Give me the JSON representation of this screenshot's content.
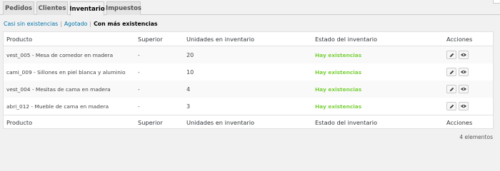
{
  "tabs": [
    "Pedidos",
    "Clientes",
    "Inventario",
    "Impuestos"
  ],
  "filters": {
    "low": "Casi sin existencias",
    "out": "Agotado",
    "most": "Con más existencias"
  },
  "columns": {
    "product": "Producto",
    "parent": "Superior",
    "units": "Unidades en inventario",
    "status": "Estado del inventario",
    "actions": "Acciones"
  },
  "rows": [
    {
      "product": "vest_005 - Mesa de comedor en madera",
      "parent": "-",
      "units": "20",
      "status": "Hay existencias"
    },
    {
      "product": "cami_009 - Sillones en piel blanca y aluminio",
      "parent": "-",
      "units": "10",
      "status": "Hay existencias"
    },
    {
      "product": "vest_004 - Mesitas de cama en madera",
      "parent": "-",
      "units": "4",
      "status": "Hay existencias"
    },
    {
      "product": "abri_012 - Mueble de cama en madera",
      "parent": "-",
      "units": "3",
      "status": "Hay existencias"
    }
  ],
  "item_count": "4 elementos",
  "colors": {
    "in_stock": "#7ad03a",
    "link": "#0073aa"
  },
  "icons": {
    "edit": "pencil-icon",
    "view": "eye-icon"
  }
}
